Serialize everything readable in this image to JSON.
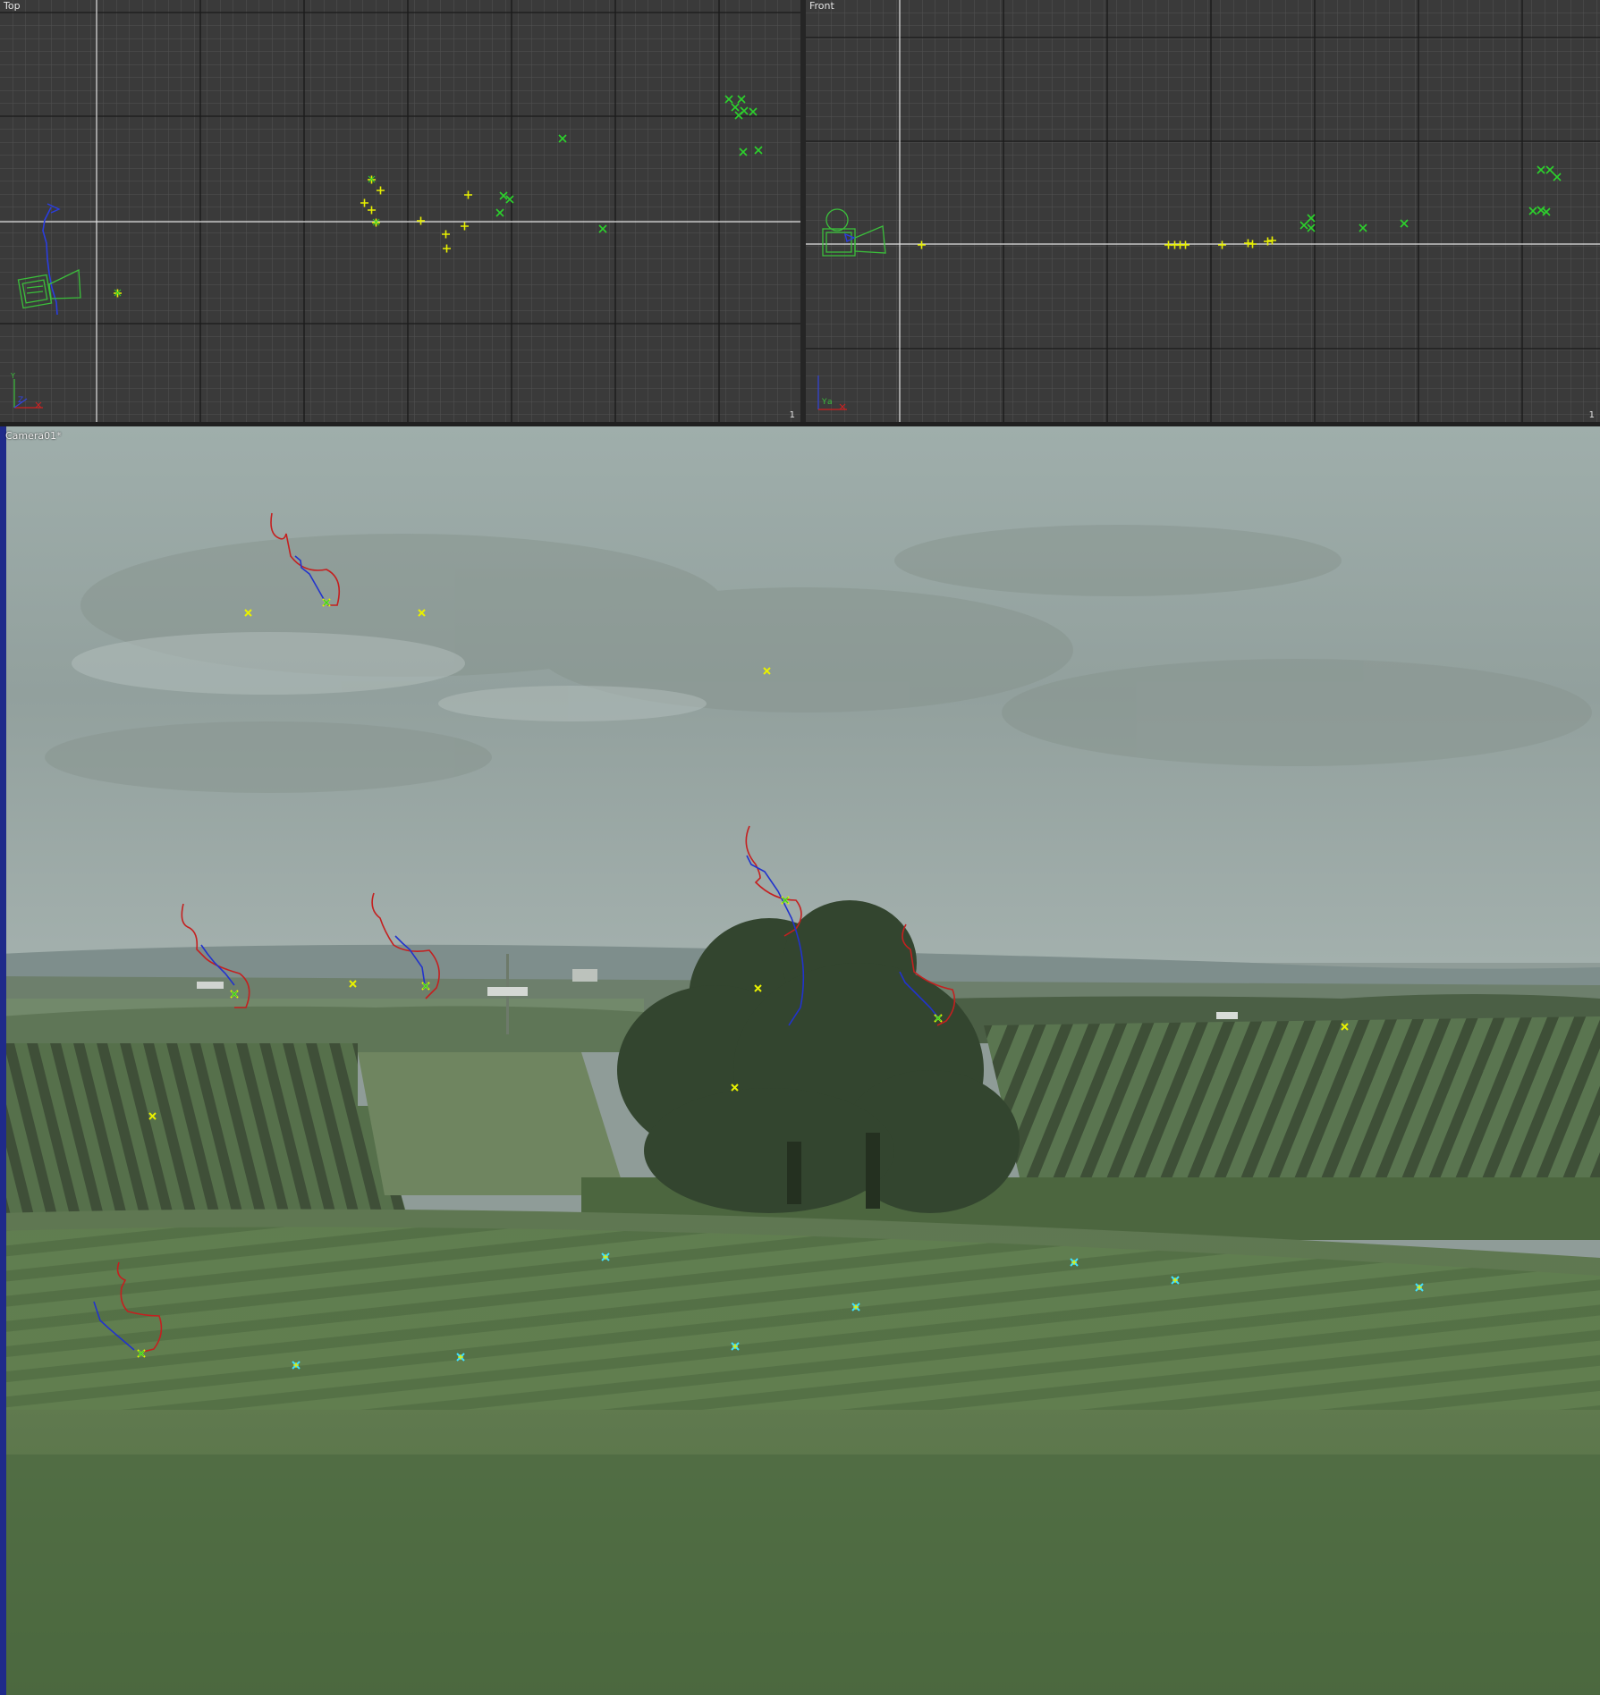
{
  "viewports": {
    "top": {
      "label": "Top",
      "number": "1",
      "axis_gizmo": {
        "x_label": "Z",
        "y_label": "Y"
      }
    },
    "front": {
      "label": "Front",
      "number": "1",
      "axis_gizmo": {
        "x_label": "Y",
        "y_label": "a"
      }
    },
    "camera": {
      "label": "Camera01*"
    }
  },
  "colors": {
    "grid_bg": "#3b3b3b",
    "grid_minor": "#4f4f4f",
    "grid_major": "#161616",
    "axis_line": "#e8e8e8",
    "marker_green": "#27c22a",
    "marker_yellow": "#e8f000",
    "marker_cyan": "#3fe1ff",
    "track_red": "#cc2222",
    "track_blue": "#2233cc",
    "camera_green": "#3bbf3b"
  },
  "icons": [
    "camera-icon",
    "axis-gizmo-icon",
    "tracking-marker-icon"
  ]
}
